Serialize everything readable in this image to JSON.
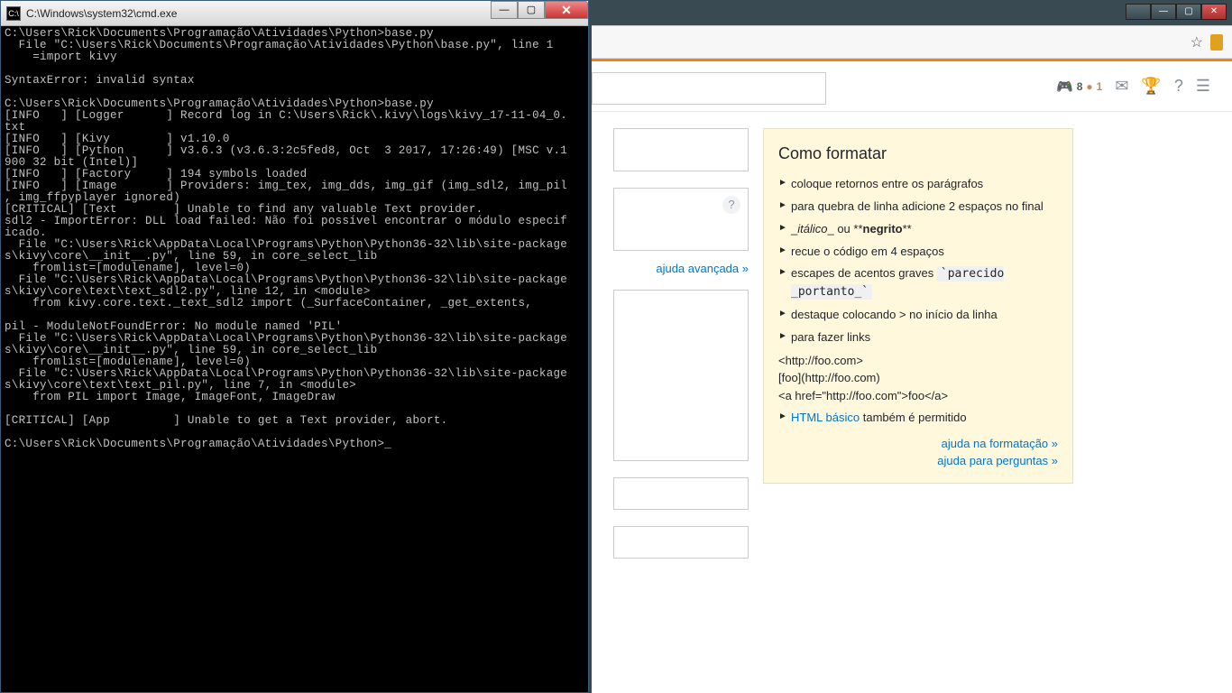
{
  "cmd": {
    "title": "C:\\Windows\\system32\\cmd.exe",
    "icon": "C:\\",
    "output": "C:\\Users\\Rick\\Documents\\Programação\\Atividades\\Python>base.py\n  File \"C:\\Users\\Rick\\Documents\\Programação\\Atividades\\Python\\base.py\", line 1\n    =import kivy\n\nSyntaxError: invalid syntax\n\nC:\\Users\\Rick\\Documents\\Programação\\Atividades\\Python>base.py\n[INFO   ] [Logger      ] Record log in C:\\Users\\Rick\\.kivy\\logs\\kivy_17-11-04_0.\ntxt\n[INFO   ] [Kivy        ] v1.10.0\n[INFO   ] [Python      ] v3.6.3 (v3.6.3:2c5fed8, Oct  3 2017, 17:26:49) [MSC v.1\n900 32 bit (Intel)]\n[INFO   ] [Factory     ] 194 symbols loaded\n[INFO   ] [Image       ] Providers: img_tex, img_dds, img_gif (img_sdl2, img_pil\n, img_ffpyplayer ignored)\n[CRITICAL] [Text        ] Unable to find any valuable Text provider.\nsdl2 - ImportError: DLL load failed: Não foi possível encontrar o módulo especif\nicado.\n  File \"C:\\Users\\Rick\\AppData\\Local\\Programs\\Python\\Python36-32\\lib\\site-package\ns\\kivy\\core\\__init__.py\", line 59, in core_select_lib\n    fromlist=[modulename], level=0)\n  File \"C:\\Users\\Rick\\AppData\\Local\\Programs\\Python\\Python36-32\\lib\\site-package\ns\\kivy\\core\\text\\text_sdl2.py\", line 12, in <module>\n    from kivy.core.text._text_sdl2 import (_SurfaceContainer, _get_extents,\n\npil - ModuleNotFoundError: No module named 'PIL'\n  File \"C:\\Users\\Rick\\AppData\\Local\\Programs\\Python\\Python36-32\\lib\\site-package\ns\\kivy\\core\\__init__.py\", line 59, in core_select_lib\n    fromlist=[modulename], level=0)\n  File \"C:\\Users\\Rick\\AppData\\Local\\Programs\\Python\\Python36-32\\lib\\site-package\ns\\kivy\\core\\text\\text_pil.py\", line 7, in <module>\n    from PIL import Image, ImageFont, ImageDraw\n\n[CRITICAL] [App         ] Unable to get a Text provider, abort.\n\nC:\\Users\\Rick\\Documents\\Programação\\Atividades\\Python>"
  },
  "topbar": {
    "rep": "8",
    "bronze": "1"
  },
  "format": {
    "title": "Como formatar",
    "items": {
      "i1": "coloque retornos entre os parágrafos",
      "i2": "para quebra de linha adicione 2 espaços no final",
      "i3_pre": "_",
      "i3_ital": "itálico",
      "i3_mid": "_ ou **",
      "i3_bold": "negrito",
      "i3_post": "**",
      "i4": "recue o código em 4 espaços",
      "i5_a": "escapes de acentos graves ",
      "i5_code": "`parecido _portanto_`",
      "i6": "destaque colocando > no início da linha",
      "i7": "para fazer links",
      "ex1": "<http://foo.com>",
      "ex2": "[foo](http://foo.com)",
      "ex3": "<a href=\"http://foo.com\">foo</a>",
      "i8_link": "HTML básico",
      "i8_rest": " também é permitido"
    },
    "links": {
      "l1": "ajuda na formatação »",
      "l2": "ajuda para perguntas »"
    }
  },
  "adv_link": "ajuda avançada »"
}
